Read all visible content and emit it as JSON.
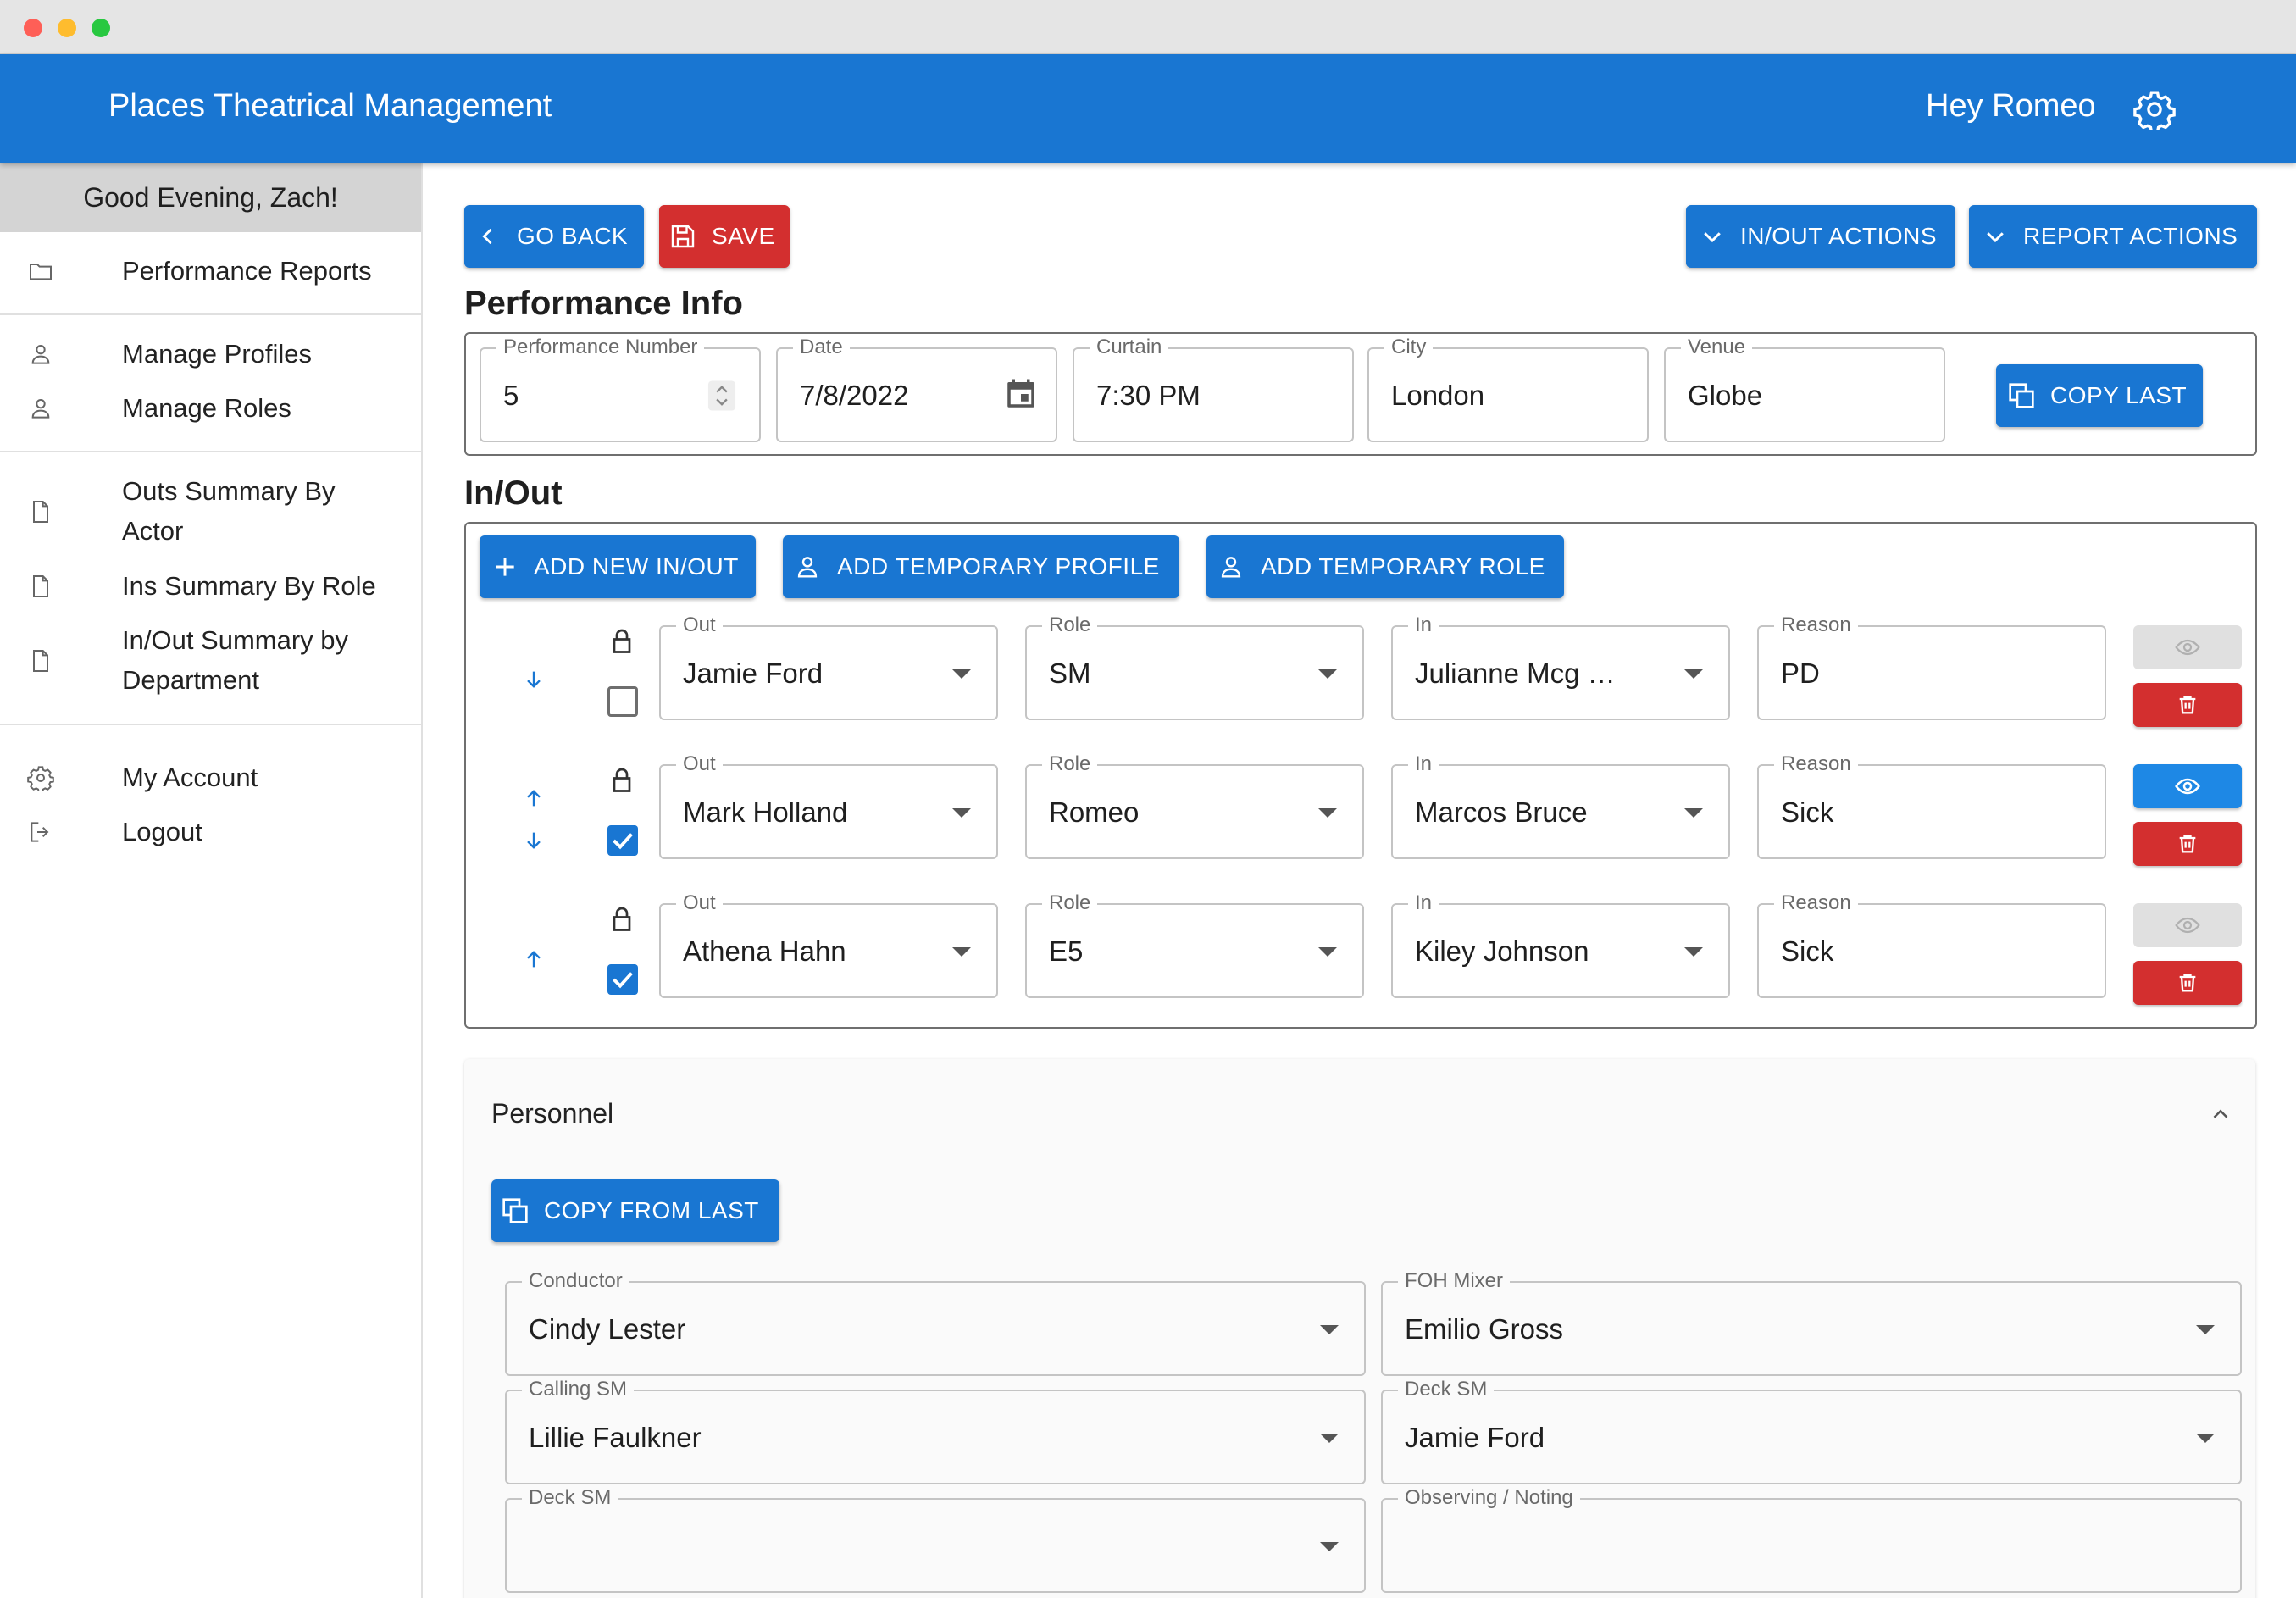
{
  "app": {
    "title": "Places Theatrical Management",
    "user_greeting": "Hey Romeo"
  },
  "sidebar": {
    "greeting": "Good Evening, Zach!",
    "items": [
      {
        "label": "Performance Reports",
        "icon": "folder-icon"
      },
      {
        "label": "Manage Profiles",
        "icon": "person-icon"
      },
      {
        "label": "Manage Roles",
        "icon": "person-icon"
      },
      {
        "label": "Outs Summary By Actor",
        "icon": "document-icon"
      },
      {
        "label": "Ins Summary By Role",
        "icon": "document-icon"
      },
      {
        "label": "In/Out Summary by Department",
        "icon": "document-icon"
      },
      {
        "label": "My Account",
        "icon": "gear-icon"
      },
      {
        "label": "Logout",
        "icon": "logout-icon"
      }
    ]
  },
  "toolbar": {
    "go_back": "GO BACK",
    "save": "SAVE",
    "inout_actions": "IN/OUT ACTIONS",
    "report_actions": "REPORT ACTIONS"
  },
  "performance_info": {
    "title": "Performance Info",
    "fields": {
      "performance_number": {
        "label": "Performance Number",
        "value": "5"
      },
      "date": {
        "label": "Date",
        "value": "7/8/2022"
      },
      "curtain": {
        "label": "Curtain",
        "value": "7:30 PM"
      },
      "city": {
        "label": "City",
        "value": "London"
      },
      "venue": {
        "label": "Venue",
        "value": "Globe"
      }
    },
    "copy_last": "COPY LAST"
  },
  "inout": {
    "title": "In/Out",
    "add_new": "ADD NEW IN/OUT",
    "add_temp_profile": "ADD TEMPORARY PROFILE",
    "add_temp_role": "ADD TEMPORARY ROLE",
    "labels": {
      "out": "Out",
      "role": "Role",
      "in": "In",
      "reason": "Reason"
    },
    "rows": [
      {
        "out": "Jamie Ford",
        "role": "SM",
        "in": "Julianne Mcg …",
        "reason": "PD",
        "checked": false,
        "view_enabled": false
      },
      {
        "out": "Mark Holland",
        "role": "Romeo",
        "in": "Marcos Bruce",
        "reason": "Sick",
        "checked": true,
        "view_enabled": true
      },
      {
        "out": "Athena Hahn",
        "role": "E5",
        "in": "Kiley Johnson",
        "reason": "Sick",
        "checked": true,
        "view_enabled": false
      }
    ]
  },
  "personnel": {
    "title": "Personnel",
    "copy_from_last": "COPY FROM LAST",
    "fields": [
      {
        "label": "Conductor",
        "value": "Cindy Lester"
      },
      {
        "label": "FOH Mixer",
        "value": "Emilio Gross"
      },
      {
        "label": "Calling SM",
        "value": "Lillie Faulkner"
      },
      {
        "label": "Deck SM",
        "value": "Jamie Ford"
      },
      {
        "label": "Deck SM",
        "value": ""
      },
      {
        "label": "Observing / Noting",
        "value": ""
      }
    ]
  },
  "colors": {
    "primary": "#1976d2",
    "danger": "#d32f2f",
    "view_active": "#1e88e5"
  }
}
